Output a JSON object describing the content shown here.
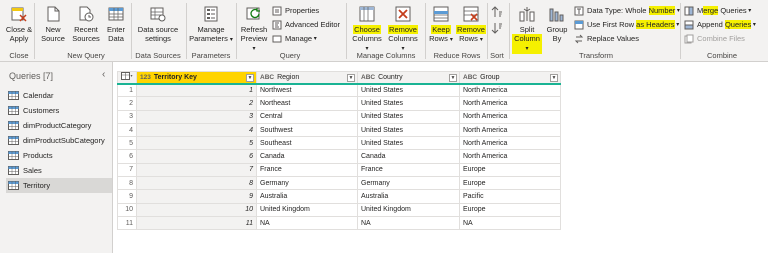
{
  "ribbon": {
    "close_group": {
      "close_apply": "Close &",
      "close_apply_2": "Apply",
      "label": "Close"
    },
    "new_query_group": {
      "new_source": "New",
      "new_source_2": "Source",
      "recent_sources": "Recent",
      "recent_sources_2": "Sources",
      "enter_data": "Enter",
      "enter_data_2": "Data",
      "label": "New Query"
    },
    "data_sources_group": {
      "settings": "Data source",
      "settings_2": "settings",
      "label": "Data Sources"
    },
    "parameters_group": {
      "manage": "Manage",
      "manage_2": "Parameters",
      "label": "Parameters"
    },
    "query_group": {
      "refresh": "Refresh",
      "refresh_2": "Preview",
      "properties": "Properties",
      "advanced_editor": "Advanced Editor",
      "manage": "Manage",
      "label": "Query"
    },
    "manage_columns_group": {
      "choose": "Choose",
      "choose_2": "Columns",
      "remove": "Remove",
      "remove_2": "Columns",
      "label": "Manage Columns"
    },
    "reduce_rows_group": {
      "keep": "Keep",
      "keep_2": "Rows",
      "remove": "Remove",
      "remove_2": "Rows",
      "label": "Reduce Rows"
    },
    "sort_group": {
      "label": "Sort"
    },
    "transform_group": {
      "split": "Split",
      "split_2": "Column",
      "group_by": "Group",
      "group_by_2": "By",
      "data_type_prefix": "Data Type: Whole ",
      "data_type_hl": "Number",
      "first_row_prefix": "Use First Row ",
      "first_row_hl": "as Headers",
      "replace_values": "Replace Values",
      "label": "Transform"
    },
    "combine_group": {
      "merge_prefix": "M",
      "merge_hl": "erge",
      "merge_suffix": " Queries",
      "append_prefix": "Append ",
      "append_hl": "Queries",
      "combine_files": "Combine Files",
      "label": "Combine"
    }
  },
  "queries_pane": {
    "header": "Queries [7]",
    "items": [
      "Calendar",
      "Customers",
      "dimProductCategory",
      "dimProductSubCategory",
      "Products",
      "Sales",
      "Territory"
    ],
    "selected": "Territory"
  },
  "grid": {
    "columns": [
      {
        "type": "123",
        "name": "Territory Key"
      },
      {
        "type": "ABC",
        "name": "Region"
      },
      {
        "type": "ABC",
        "name": "Country"
      },
      {
        "type": "ABC",
        "name": "Group"
      }
    ],
    "rows": [
      [
        "1",
        "1",
        "Northwest",
        "United States",
        "North America"
      ],
      [
        "2",
        "2",
        "Northeast",
        "United States",
        "North America"
      ],
      [
        "3",
        "3",
        "Central",
        "United States",
        "North America"
      ],
      [
        "4",
        "4",
        "Southwest",
        "United States",
        "North America"
      ],
      [
        "5",
        "5",
        "Southeast",
        "United States",
        "North America"
      ],
      [
        "6",
        "6",
        "Canada",
        "Canada",
        "North America"
      ],
      [
        "7",
        "7",
        "France",
        "France",
        "Europe"
      ],
      [
        "8",
        "8",
        "Germany",
        "Germany",
        "Europe"
      ],
      [
        "9",
        "9",
        "Australia",
        "Australia",
        "Pacific"
      ],
      [
        "10",
        "10",
        "United Kingdom",
        "United Kingdom",
        "Europe"
      ],
      [
        "11",
        "11",
        "NA",
        "NA",
        "NA"
      ]
    ]
  },
  "colors": {
    "highlight": "#f5f000",
    "selected_column": "#ffd400",
    "quality_bar": "#1ab394"
  }
}
